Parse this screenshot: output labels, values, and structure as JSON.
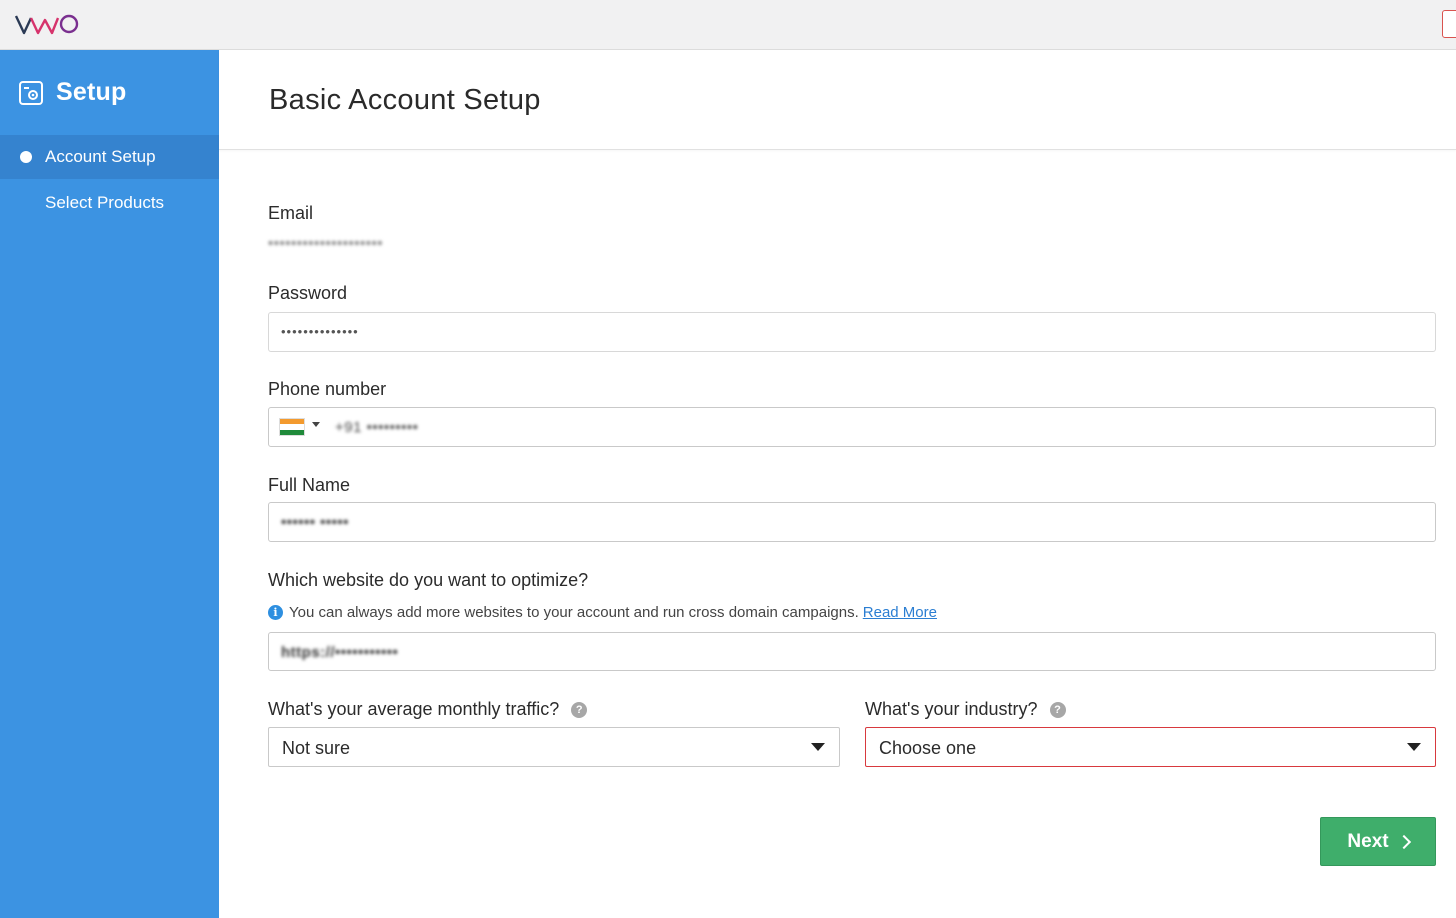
{
  "brand": {
    "logo_text": "VWO",
    "accent": "#3c93e2",
    "error": "#d8393e",
    "success": "#3fae6b"
  },
  "sidebar": {
    "title": "Setup",
    "items": [
      {
        "label": "Account Setup",
        "active": true
      },
      {
        "label": "Select Products",
        "active": false
      }
    ]
  },
  "page": {
    "title": "Basic Account Setup"
  },
  "form": {
    "email": {
      "label": "Email",
      "value": "••••••••••••••••••••"
    },
    "password": {
      "label": "Password",
      "value": "••••••••••••••"
    },
    "phone": {
      "label": "Phone number",
      "country": "India",
      "value": "+91 •••••••••"
    },
    "full_name": {
      "label": "Full Name",
      "value": "•••••• •••••"
    },
    "website": {
      "label": "Which website do you want to optimize?",
      "hint": "You can always add more websites to your account and run cross domain campaigns.",
      "hint_link": "Read More",
      "value": "https://•••••••••••"
    },
    "traffic": {
      "label": "What's your average monthly traffic?",
      "selected": "Not sure"
    },
    "industry": {
      "label": "What's your industry?",
      "selected": "Choose one"
    }
  },
  "actions": {
    "next_label": "Next"
  }
}
